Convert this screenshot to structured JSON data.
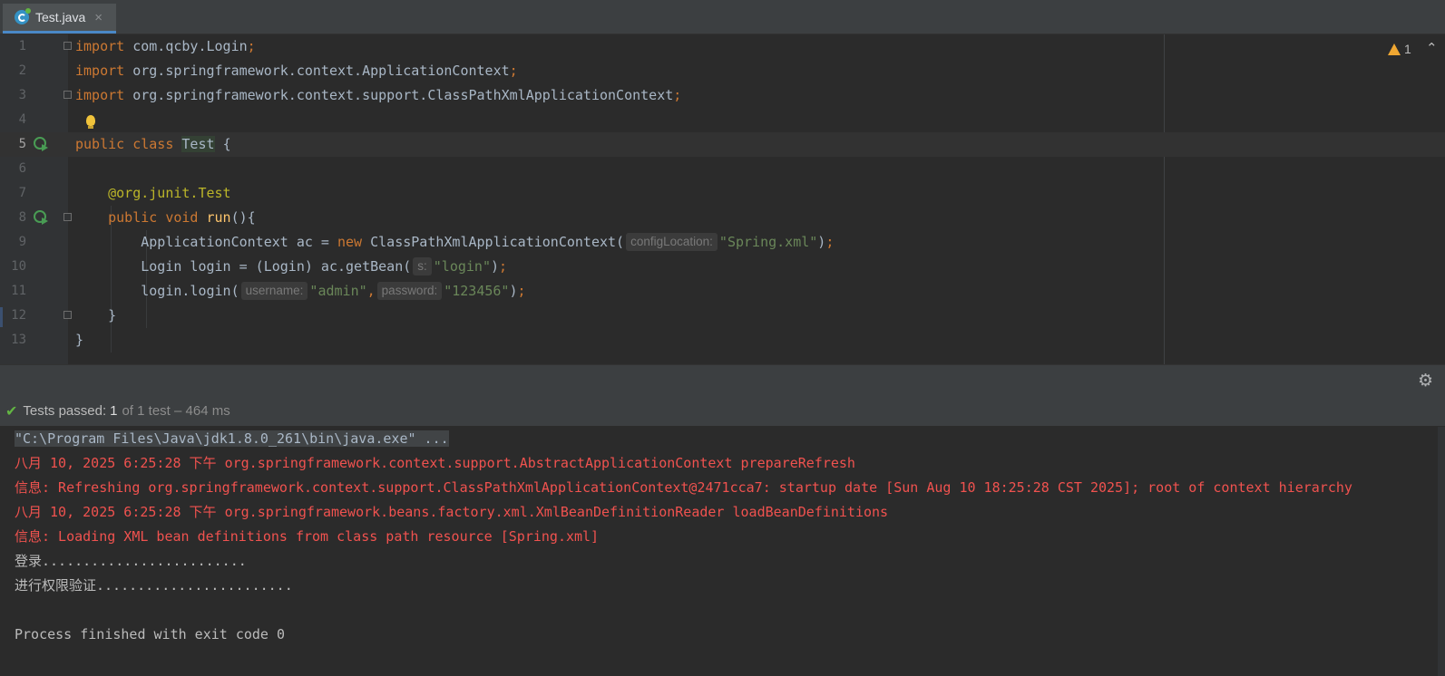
{
  "tab": {
    "label": "Test.java",
    "close": "×"
  },
  "editor": {
    "line_numbers": [
      "1",
      "2",
      "3",
      "4",
      "5",
      "6",
      "7",
      "8",
      "9",
      "10",
      "11",
      "12",
      "13"
    ],
    "warnings": {
      "count": "1"
    },
    "lines": {
      "l1": {
        "kw": "import",
        "pkg": "com.qcby.Login",
        "semi": ";"
      },
      "l2": {
        "kw": "import",
        "pkg": "org.springframework.context.ApplicationContext",
        "semi": ";"
      },
      "l3": {
        "kw": "import",
        "pkg": "org.springframework.context.support.ClassPathXmlApplicationContext",
        "semi": ";"
      },
      "l5": {
        "kw1": "public",
        "kw2": "class",
        "name": "Test",
        "brace": "{"
      },
      "l7": {
        "at": "@org.junit.",
        "ann": "Test"
      },
      "l8": {
        "kw1": "public",
        "kw2": "void",
        "fn": "run",
        "rest": "(){"
      },
      "l9": {
        "pre": "ApplicationContext ac = ",
        "kw": "new",
        "mid": "ClassPathXmlApplicationContext(",
        "hint": "configLocation:",
        "str": "\"Spring.xml\"",
        "close": ")",
        "semi": ";"
      },
      "l10": {
        "pre": "Login login = (Login) ac.getBean(",
        "hint": "s:",
        "str": "\"login\"",
        "close": ")",
        "semi": ";"
      },
      "l11": {
        "pre": "login.login(",
        "hint1": "username:",
        "str1": "\"admin\"",
        "comma": ",",
        "hint2": "password:",
        "str2": "\"123456\"",
        "close": ")",
        "semi": ";"
      },
      "l12": {
        "brace": "}"
      },
      "l13": {
        "brace": "}"
      }
    }
  },
  "test_status": {
    "label": "Tests passed:",
    "count": "1",
    "rest": "of 1 test – 464 ms"
  },
  "console": {
    "command": "\"C:\\Program Files\\Java\\jdk1.8.0_261\\bin\\java.exe\" ...",
    "log1": "八月 10, 2025 6:25:28 下午 org.springframework.context.support.AbstractApplicationContext prepareRefresh",
    "log2": "信息: Refreshing org.springframework.context.support.ClassPathXmlApplicationContext@2471cca7: startup date [Sun Aug 10 18:25:28 CST 2025]; root of context hierarchy",
    "log3": "八月 10, 2025 6:25:28 下午 org.springframework.beans.factory.xml.XmlBeanDefinitionReader loadBeanDefinitions",
    "log4": "信息: Loading XML bean definitions from class path resource [Spring.xml]",
    "out1": "登录.........................",
    "out2": "进行权限验证........................",
    "finish": "Process finished with exit code 0"
  },
  "colors": {
    "keyword": "#cc7832",
    "string": "#6a8759",
    "annotation": "#bbb529",
    "error_log": "#f0524f",
    "pass": "#62b543"
  },
  "icons": [
    "java-class-icon",
    "run-test-icon",
    "fold-icon",
    "intention-bulb-icon",
    "warning-icon",
    "chevron-up-icon",
    "gear-icon",
    "check-icon"
  ]
}
